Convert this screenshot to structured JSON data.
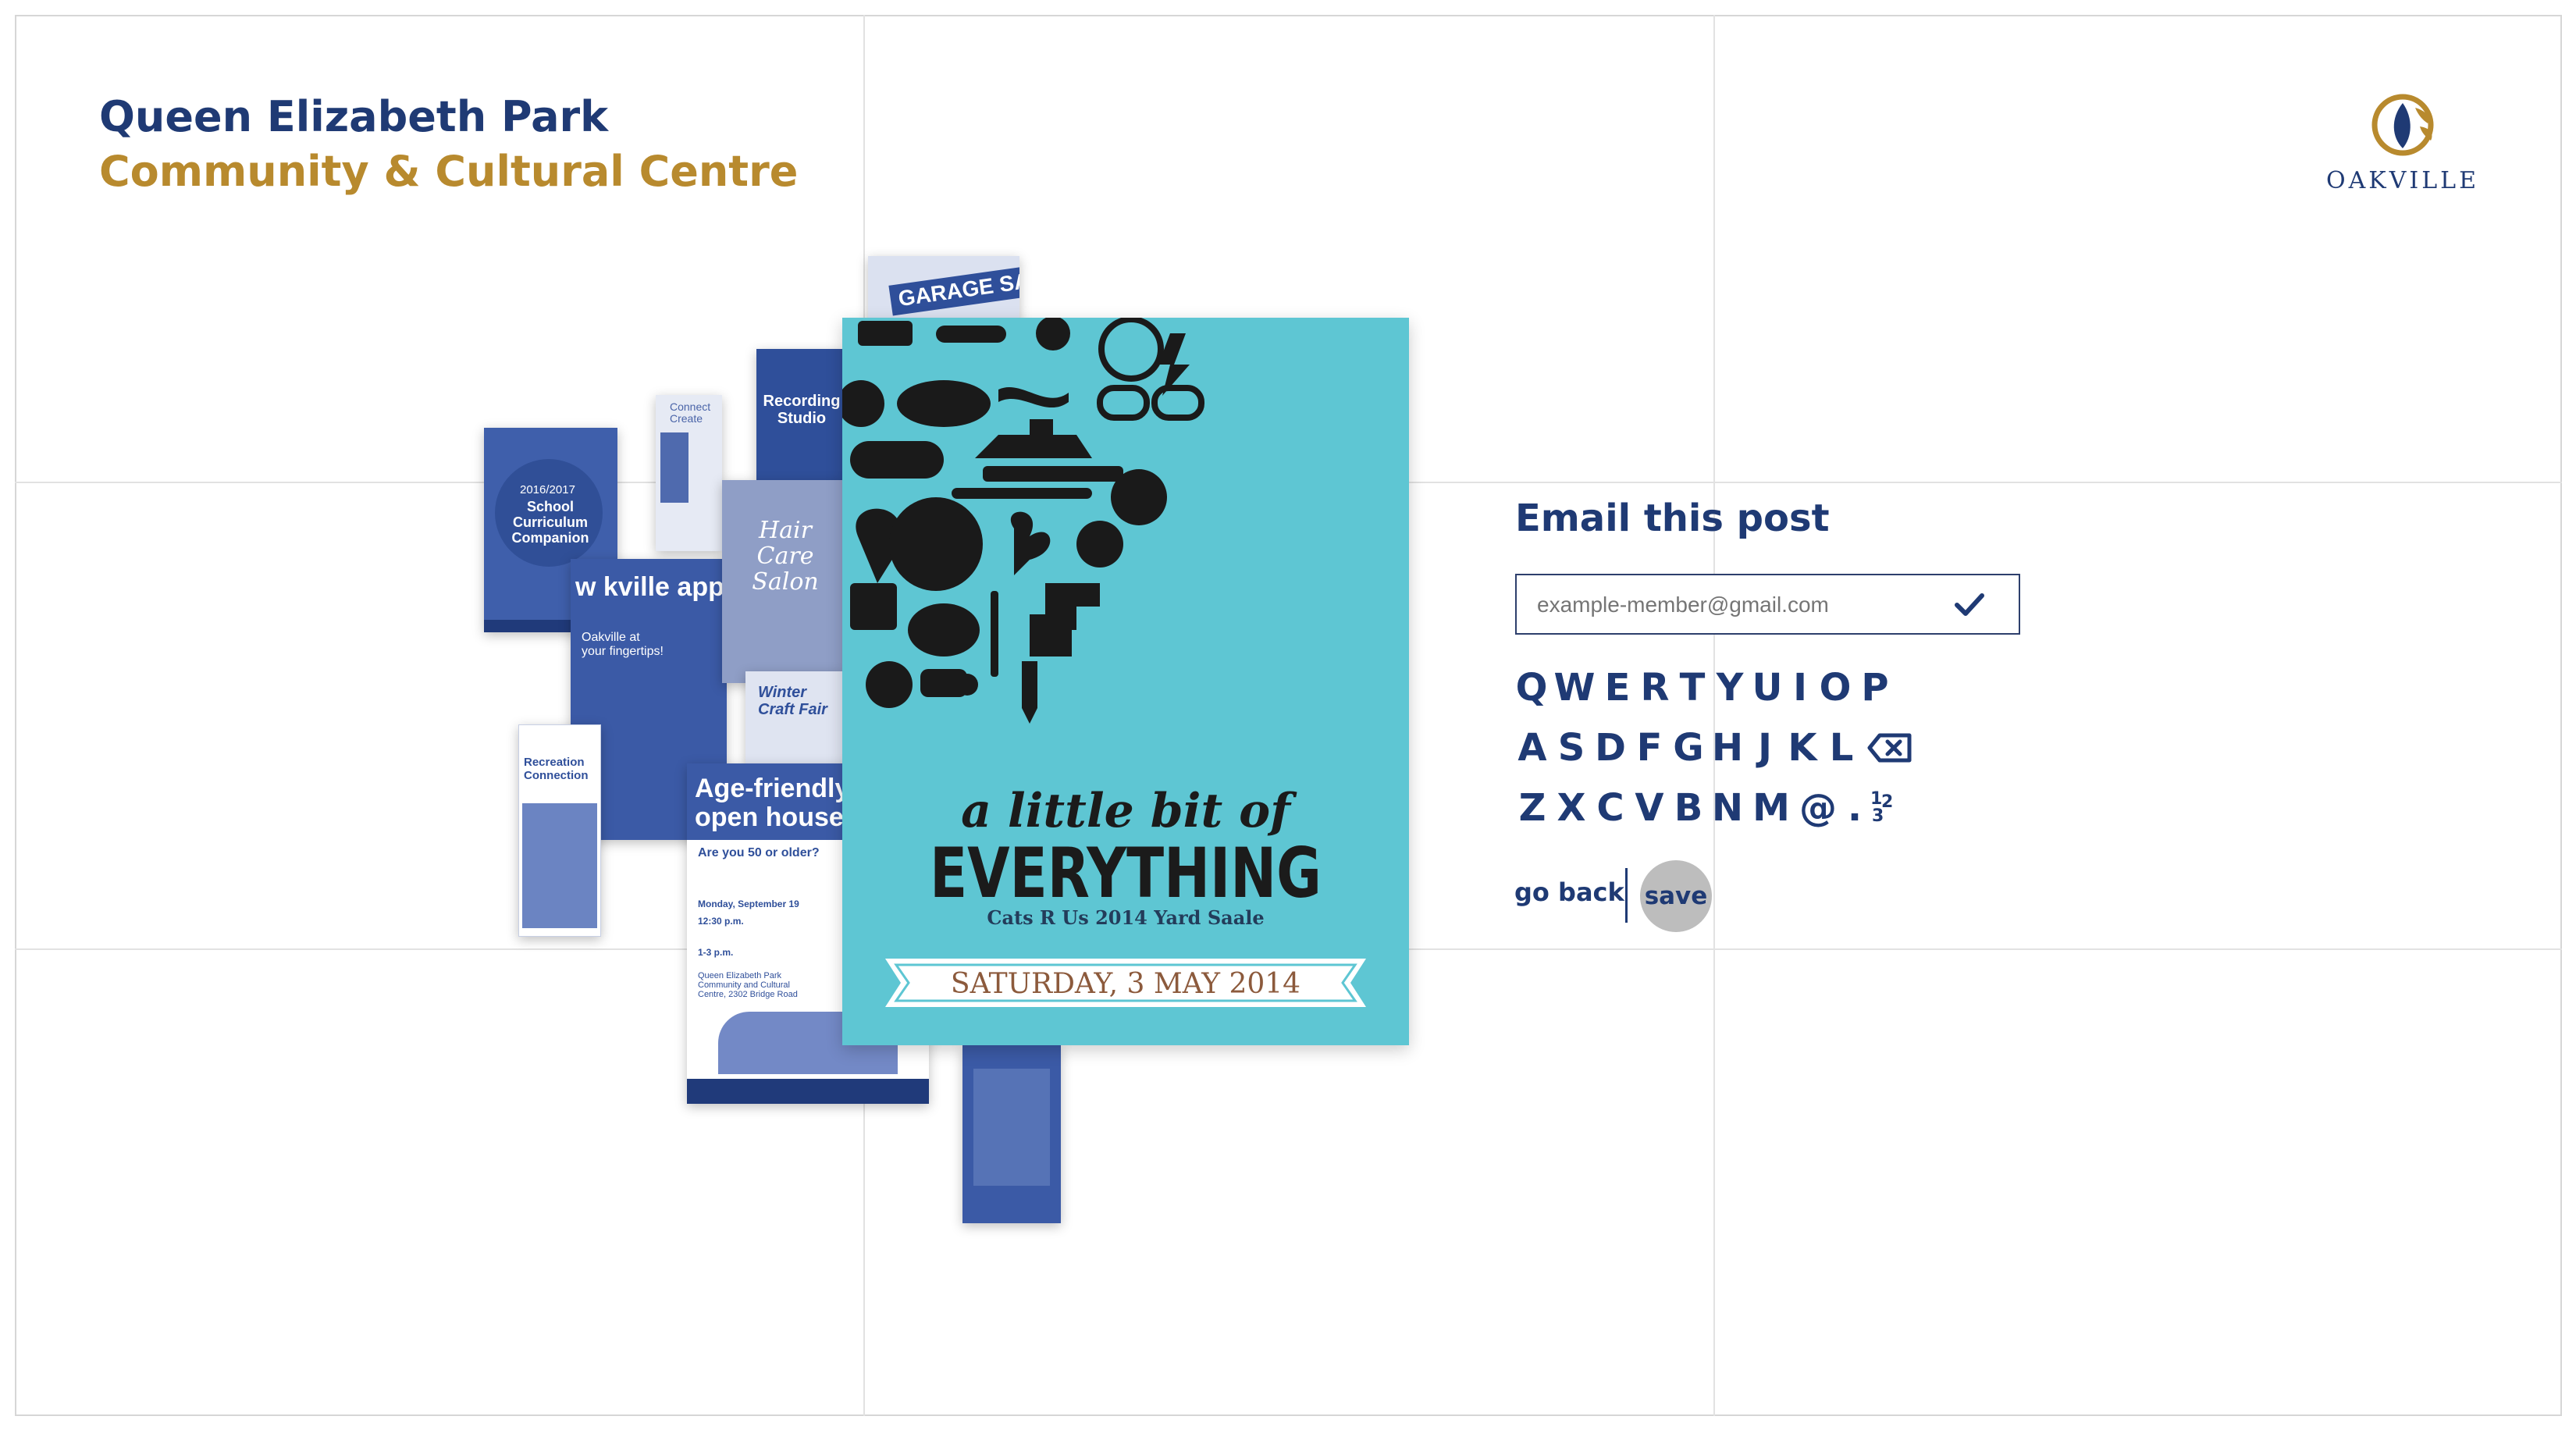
{
  "header": {
    "title_line1": "Queen Elizabeth Park",
    "title_line2": "Community & Cultural Centre"
  },
  "logo": {
    "text": "OAKVILLE",
    "icon": "oakville-leaf-icon"
  },
  "colors": {
    "navy": "#1f3a74",
    "gold": "#b88a2e",
    "poster_blue": "#2f4f9a",
    "feature_teal": "#5ec6d3",
    "save_grey": "#bdbdbd"
  },
  "posters": {
    "garage": {
      "label": "GARAGE SALE"
    },
    "curriculum": {
      "year": "2016/2017",
      "title": "School Curriculum Companion"
    },
    "connect": {
      "label": "Connect Create"
    },
    "recording": {
      "label": "Recording Studio"
    },
    "app": {
      "headline": "w kville app",
      "sub": "Oakville at your fingertips!"
    },
    "hair": {
      "label": "Hair Care Salon"
    },
    "craft": {
      "label": "Winter Craft Fair"
    },
    "recreation": {
      "label": "Recreation Connection"
    },
    "agefriendly": {
      "headline": "Age-friendly open house",
      "question": "Are you 50 or older?",
      "date": "Monday, September 19",
      "time1": "12:30 p.m.",
      "time2": "1-3 p.m.",
      "venue": "Queen Elizabeth Park Community and Cultural Centre, 2302 Bridge Road"
    }
  },
  "feature_post": {
    "line1": "a little bit of",
    "line2": "EVERYTHING",
    "subtitle": "Cats  R Us 2014 Yard Saale",
    "date_banner": "SATURDAY, 3 MAY 2014"
  },
  "email": {
    "heading": "Email this post",
    "value": "",
    "placeholder": "example-member@gmail.com"
  },
  "keyboard": {
    "row1": [
      "Q",
      "W",
      "E",
      "R",
      "T",
      "Y",
      "U",
      "I",
      "O",
      "P"
    ],
    "row2": [
      "A",
      "S",
      "D",
      "F",
      "G",
      "H",
      "J",
      "K",
      "L"
    ],
    "row3": [
      "Z",
      "X",
      "C",
      "V",
      "B",
      "N",
      "M",
      "@",
      "."
    ],
    "numbers_key": [
      "1",
      "2",
      "3"
    ]
  },
  "actions": {
    "go_back": "go back",
    "save": "save"
  }
}
